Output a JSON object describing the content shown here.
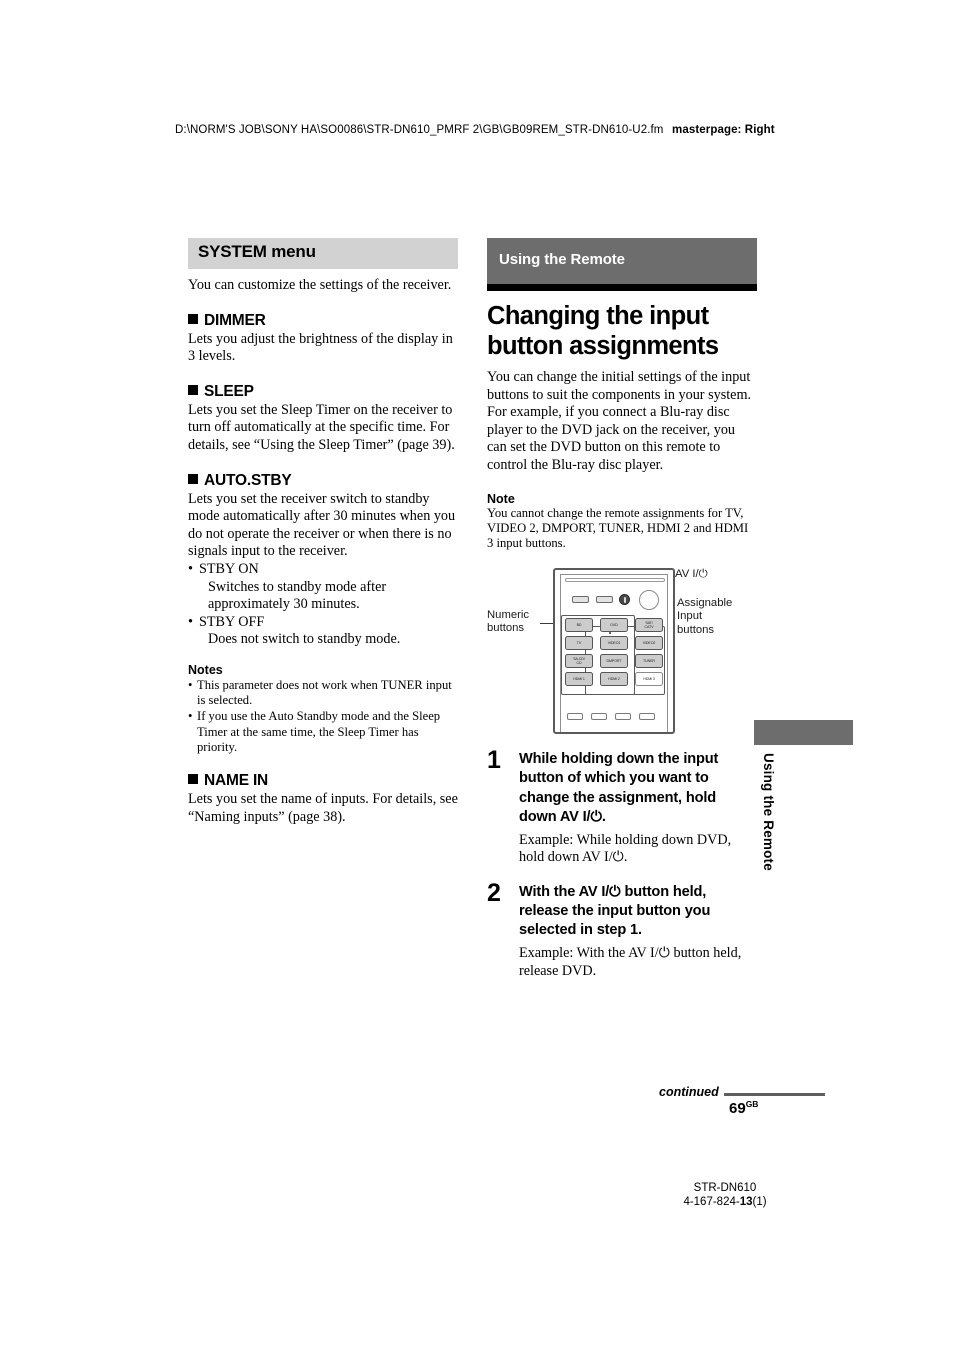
{
  "header": {
    "path": "D:\\NORM'S JOB\\SONY HA\\SO0086\\STR-DN610_PMRF 2\\GB\\GB09REM_STR-DN610-U2.fm",
    "masterpage": "masterpage: Right"
  },
  "left_column": {
    "menu_band": "SYSTEM menu",
    "intro": "You can customize the settings of the receiver.",
    "dimmer": {
      "head": "DIMMER",
      "body": "Lets you adjust the brightness of the display in 3 levels."
    },
    "sleep": {
      "head": "SLEEP",
      "body": "Lets you set the Sleep Timer on the receiver to turn off automatically at the specific time. For details, see “Using the Sleep Timer” (page 39)."
    },
    "auto_stby": {
      "head": "AUTO.STBY",
      "body": "Lets you set the receiver switch to standby mode automatically after 30 minutes when you do not operate the receiver or when there is no signals input to the receiver.",
      "options": [
        {
          "label": "STBY ON",
          "desc": "Switches to standby mode after approximately 30 minutes."
        },
        {
          "label": "STBY OFF",
          "desc": "Does not switch to standby mode."
        }
      ],
      "notes_head": "Notes",
      "notes": [
        "This parameter does not work when TUNER input is selected.",
        "If you use the Auto Standby mode and the Sleep Timer at the same time, the Sleep Timer has priority."
      ]
    },
    "name_in": {
      "head": "NAME IN",
      "body": "Lets you set the name of inputs. For details, see “Naming inputs” (page 38)."
    }
  },
  "right_column": {
    "section_band": "Using the Remote",
    "chapter_title": "Changing the input button assignments",
    "intro": "You can change the initial settings of the input buttons to suit the components in your system. For example, if you connect a Blu-ray disc player to the DVD jack on the receiver, you can set the DVD button on this remote to control the Blu-ray disc player.",
    "note_head": "Note",
    "note_body": "You cannot change the remote assignments for TV, VIDEO 2, DMPORT, TUNER, HDMI 2 and HDMI 3 input buttons.",
    "figure": {
      "callouts": {
        "av_power": "AV I/⏻",
        "numeric": "Numeric\nbuttons",
        "assignable": "Assignable\nInput\nbuttons"
      },
      "buttons": [
        {
          "label": "BD",
          "style": "shaded"
        },
        {
          "label": "DVD",
          "style": "shaded"
        },
        {
          "label": "SAT/\nCATV",
          "style": "shaded"
        },
        {
          "label": "TV",
          "style": "shaded"
        },
        {
          "label": "VIDEO1",
          "style": "shaded"
        },
        {
          "label": "VIDEO2",
          "style": "shaded"
        },
        {
          "label": "SA-CD/\nCD",
          "style": "shaded"
        },
        {
          "label": "DMPORT",
          "style": "shaded"
        },
        {
          "label": "TUNER",
          "style": "shaded"
        },
        {
          "label": "HDMI 1",
          "style": "shaded"
        },
        {
          "label": "HDMI 2",
          "style": "shaded"
        },
        {
          "label": "HDMI 3",
          "style": "plain"
        }
      ]
    },
    "steps": [
      {
        "num": "1",
        "title": "While holding down the input button of which you want to change the assignment, hold down AV I/⏻.",
        "example": "Example: While holding down DVD, hold down AV I/⏻."
      },
      {
        "num": "2",
        "title": "With the AV I/⏻ button held, release the input button you selected in step 1.",
        "example": "Example: With the AV I/⏻ button held, release DVD."
      }
    ]
  },
  "side_tab": "Using the Remote",
  "footer": {
    "continued": "continued",
    "page_number": "69",
    "page_suffix": "GB",
    "model": "STR-DN610",
    "part_prefix": "4-167-824-",
    "part_bold": "13",
    "part_suffix": "(1)"
  }
}
